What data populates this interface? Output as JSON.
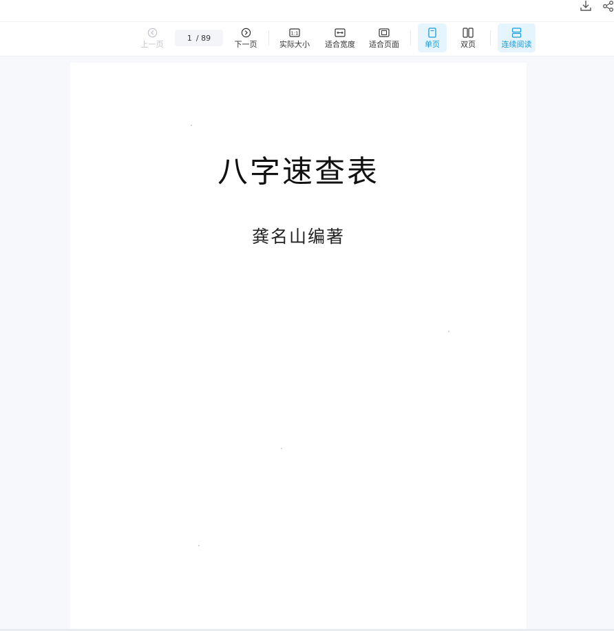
{
  "top_actions": {
    "download_icon": "download-icon",
    "share_icon": "share-icon"
  },
  "toolbar": {
    "prev_label": "上一页",
    "page_current": "1",
    "page_total": "/ 89",
    "next_label": "下一页",
    "actual_size_label": "实际大小",
    "fit_width_label": "适合宽度",
    "fit_page_label": "适合页面",
    "single_page_label": "单页",
    "double_page_label": "双页",
    "continuous_label": "连续阅读",
    "accent_color": "#1a9ad6"
  },
  "document": {
    "title": "八字速查表",
    "author": "龚名山编著"
  }
}
